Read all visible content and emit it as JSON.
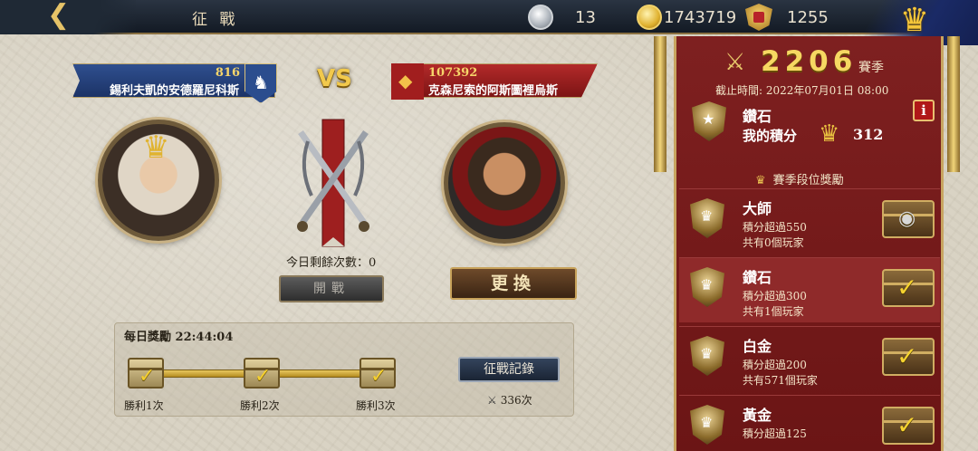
{
  "topbar": {
    "title": "征 戰",
    "silver": "13",
    "gold": "1743719",
    "honor": "1255"
  },
  "battle": {
    "vs": "VS",
    "left": {
      "power": "816",
      "name": "錫利夫凱的安德羅尼科斯"
    },
    "right": {
      "power": "107392",
      "name": "克森尼索的阿斯圖裡烏斯"
    },
    "remaining": "今日剩餘次數：0",
    "battle_button": "開戰",
    "change_button": "更換"
  },
  "daily": {
    "title": "每日獎勵 22:44:04",
    "rewards": [
      {
        "label": "勝利1次",
        "claimed": true
      },
      {
        "label": "勝利2次",
        "claimed": true
      },
      {
        "label": "勝利3次",
        "claimed": true
      }
    ],
    "record_button": "征戰記錄",
    "record_count": "336次"
  },
  "season": {
    "score": "2206",
    "label": "賽季",
    "deadline": "截止時間: 2022年07月01日 08:00",
    "current_rank": "鑽石",
    "my_score_label": "我的積分",
    "my_score": "312",
    "info_label": "i",
    "rewards_header": "賽季段位獎勵",
    "tiers": [
      {
        "name": "大師",
        "condition": "積分超過550",
        "players": "共有0個玩家",
        "status": "locked"
      },
      {
        "name": "鑽石",
        "condition": "積分超過300",
        "players": "共有1個玩家",
        "status": "claimed"
      },
      {
        "name": "白金",
        "condition": "積分超過200",
        "players": "共有571個玩家",
        "status": "claimed"
      },
      {
        "name": "黃金",
        "condition": "積分超過125",
        "players": "",
        "status": "claimed"
      }
    ]
  },
  "colors": {
    "accent_gold": "#f2c94c",
    "panel_red": "#7e2020",
    "banner_blue": "#2f4f8f",
    "banner_red": "#b32a2a"
  },
  "icons": [
    "back-arrow-icon",
    "silver-coin-icon",
    "gold-coin-icon",
    "honor-badge-icon",
    "crown-icon",
    "wolf-emblem-icon",
    "eagle-emblem-icon",
    "crossed-swords-icon",
    "chest-icon",
    "trophy-icon",
    "lock-icon",
    "checkmark-icon"
  ]
}
